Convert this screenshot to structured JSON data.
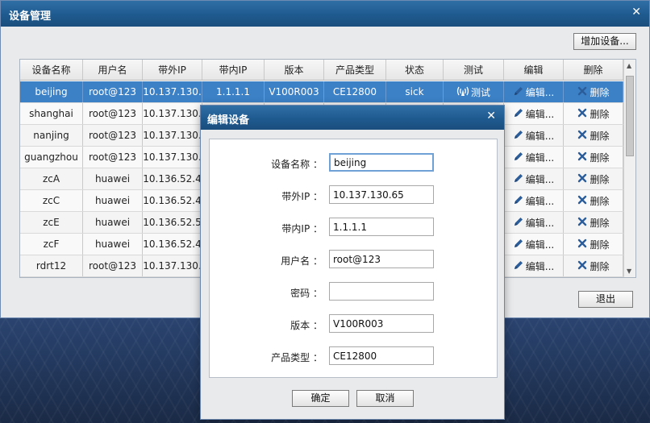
{
  "main": {
    "title": "设备管理",
    "close": "✕",
    "add_button": "增加设备...",
    "exit_button": "退出"
  },
  "table": {
    "columns": [
      "设备名称",
      "用户名",
      "带外IP",
      "带内IP",
      "版本",
      "产品类型",
      "状态",
      "测试",
      "编辑",
      "删除"
    ],
    "test_label": "测试",
    "edit_label": "编辑...",
    "delete_label": "删除",
    "rows": [
      {
        "name": "beijing",
        "user": "root@123",
        "oob_ip": "10.137.130.",
        "ib_ip": "1.1.1.1",
        "version": "V100R003",
        "product": "CE12800",
        "status": "sick"
      },
      {
        "name": "shanghai",
        "user": "root@123",
        "oob_ip": "10.137.130.",
        "ib_ip": "",
        "version": "",
        "product": "",
        "status": ""
      },
      {
        "name": "nanjing",
        "user": "root@123",
        "oob_ip": "10.137.130.",
        "ib_ip": "",
        "version": "",
        "product": "",
        "status": ""
      },
      {
        "name": "guangzhou",
        "user": "root@123",
        "oob_ip": "10.137.130.",
        "ib_ip": "",
        "version": "",
        "product": "",
        "status": ""
      },
      {
        "name": "zcA",
        "user": "huawei",
        "oob_ip": "10.136.52.4",
        "ib_ip": "",
        "version": "",
        "product": "",
        "status": ""
      },
      {
        "name": "zcC",
        "user": "huawei",
        "oob_ip": "10.136.52.4",
        "ib_ip": "",
        "version": "",
        "product": "",
        "status": ""
      },
      {
        "name": "zcE",
        "user": "huawei",
        "oob_ip": "10.136.52.5",
        "ib_ip": "",
        "version": "",
        "product": "",
        "status": ""
      },
      {
        "name": "zcF",
        "user": "huawei",
        "oob_ip": "10.136.52.4",
        "ib_ip": "",
        "version": "",
        "product": "",
        "status": ""
      },
      {
        "name": "rdrt12",
        "user": "root@123",
        "oob_ip": "10.137.130.",
        "ib_ip": "",
        "version": "",
        "product": "",
        "status": ""
      }
    ]
  },
  "dialog": {
    "title": "编辑设备",
    "close": "✕",
    "fields": {
      "name": {
        "label": "设备名称 ：",
        "value": "beijing"
      },
      "oob_ip": {
        "label": "带外IP ：",
        "value": "10.137.130.65"
      },
      "ib_ip": {
        "label": "带内IP ：",
        "value": "1.1.1.1"
      },
      "user": {
        "label": "用户名 ：",
        "value": "root@123"
      },
      "password": {
        "label": "密码 ：",
        "value": ""
      },
      "version": {
        "label": "版本 ：",
        "value": "V100R003"
      },
      "product": {
        "label": "产品类型 ：",
        "value": "CE12800"
      }
    },
    "ok_button": "确定",
    "cancel_button": "取消"
  },
  "colors": {
    "titlebar": "#1f5a8f",
    "selected_row": "#3c80c6",
    "window_bg": "#e9eaec"
  }
}
